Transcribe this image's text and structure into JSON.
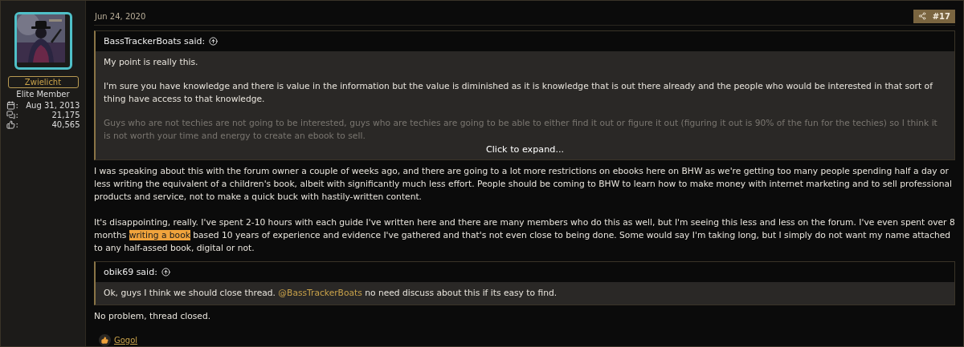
{
  "post": {
    "date": "Jun 24, 2020",
    "share_label": "#17",
    "author": {
      "username": "Zwielicht",
      "title": "Elite Member",
      "stats": [
        {
          "kind": "joined",
          "separator": ":",
          "value": "Aug 31, 2013"
        },
        {
          "kind": "messages",
          "separator": ":",
          "value": "21,175"
        },
        {
          "kind": "reactions",
          "separator": ":",
          "value": "40,565"
        }
      ]
    },
    "quotes_and_text": [
      {
        "kind": "quote",
        "attribution": "BassTrackerBoats said:",
        "collapsed": true,
        "expand_label": "Click to expand...",
        "paragraphs": [
          [
            {
              "text": "My point is really this.",
              "kind": "plain"
            }
          ],
          [
            {
              "text": "I'm sure you have knowledge and there is value in the information but the value is diminished as it is knowledge that is out there already and the people who would be interested in that sort of thing have access to that knowledge.",
              "kind": "plain"
            }
          ],
          [
            {
              "text": "Guys who are not techies are not going to be interested, guys who are techies are going to be able to either find it out or figure it out (figuring it out is 90% of the fun for the techies) so I think it is not worth your time and energy to create an ebook to sell.",
              "kind": "plain"
            }
          ]
        ]
      },
      {
        "kind": "text",
        "paragraphs": [
          [
            {
              "text": "I was speaking about this with the forum owner a couple of weeks ago, and there are going to a lot more restrictions on ebooks here on BHW as we're getting too many people spending half a day or less writing the equivalent of a children's book, albeit with significantly much less effort. People should be coming to BHW to learn how to make money with internet marketing and to sell professional products and service, not to make a quick buck with hastily-written content.",
              "kind": "plain"
            }
          ],
          [
            {
              "text": "It's disappointing, really. I've spent 2-10 hours with each guide I've written here and there are many members who do this as well, but I'm seeing this less and less on the forum. I've even spent over 8 months ",
              "kind": "plain"
            },
            {
              "text": "writing a book",
              "kind": "highlight"
            },
            {
              "text": " based 10 years of experience and evidence I've gathered and that's not even close to being done. Some would say I'm taking long, but I simply do not want my name attached to any half-assed book, digital or not.",
              "kind": "plain"
            }
          ]
        ]
      },
      {
        "kind": "quote",
        "attribution": "obik69 said:",
        "collapsed": false,
        "paragraphs": [
          [
            {
              "text": "Ok, guys I think we should close thread. ",
              "kind": "plain"
            },
            {
              "text": "@BassTrackerBoats",
              "kind": "mention"
            },
            {
              "text": " no need discuss about this if its easy to find.",
              "kind": "plain"
            }
          ]
        ]
      },
      {
        "kind": "text",
        "paragraphs": [
          [
            {
              "text": "No problem, thread closed.",
              "kind": "plain"
            }
          ]
        ]
      }
    ],
    "reactions": {
      "users": [
        "Gogol"
      ]
    }
  }
}
